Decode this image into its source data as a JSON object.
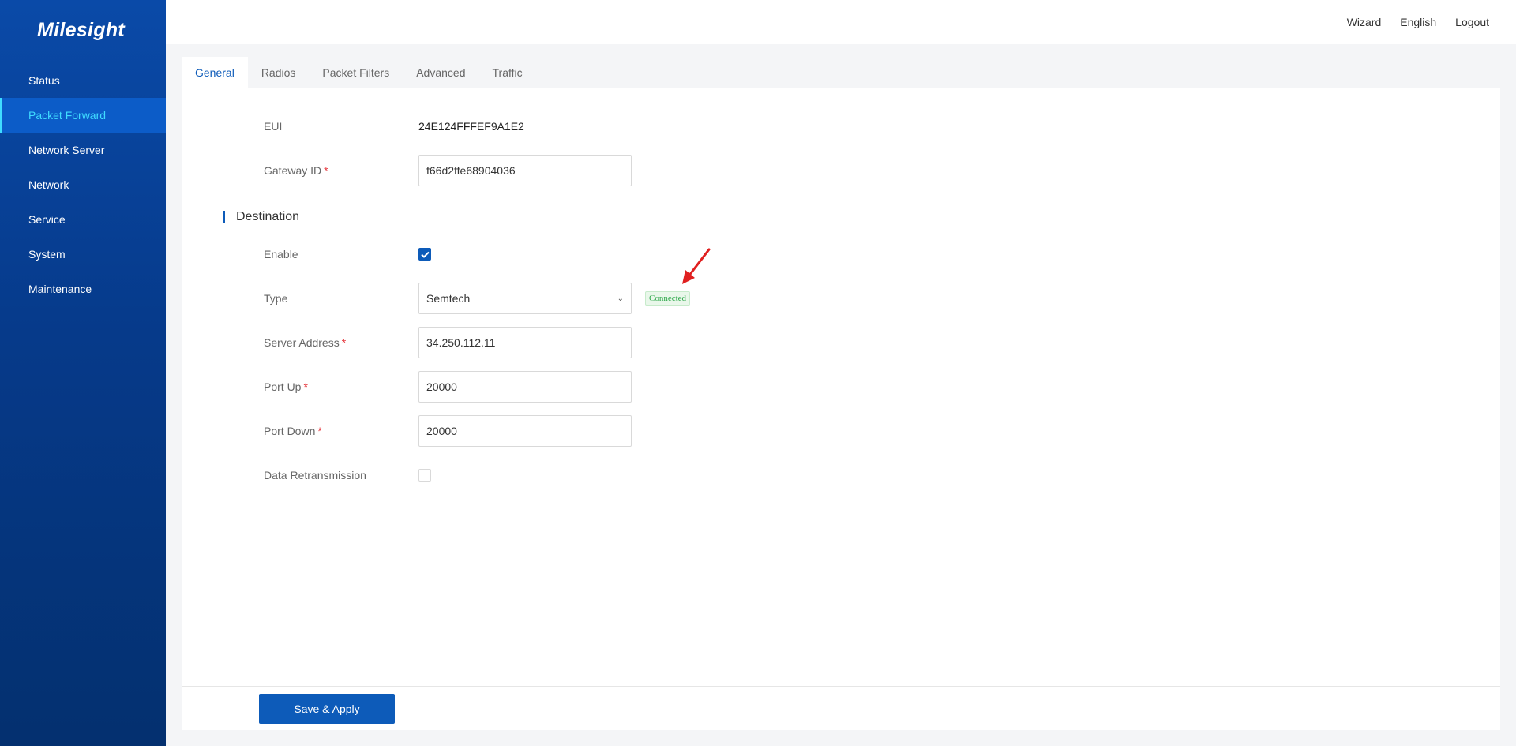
{
  "brand": {
    "logo_text": "Milesight"
  },
  "sidebar": {
    "items": [
      {
        "label": "Status"
      },
      {
        "label": "Packet Forward",
        "active": true
      },
      {
        "label": "Network Server"
      },
      {
        "label": "Network"
      },
      {
        "label": "Service"
      },
      {
        "label": "System"
      },
      {
        "label": "Maintenance"
      }
    ]
  },
  "header": {
    "wizard": "Wizard",
    "language": "English",
    "logout": "Logout"
  },
  "tabs": [
    {
      "label": "General",
      "active": true
    },
    {
      "label": "Radios"
    },
    {
      "label": "Packet Filters"
    },
    {
      "label": "Advanced"
    },
    {
      "label": "Traffic"
    }
  ],
  "form": {
    "eui": {
      "label": "EUI",
      "value": "24E124FFFEF9A1E2"
    },
    "gateway_id": {
      "label": "Gateway ID",
      "required": "*",
      "value": "f66d2ffe68904036"
    },
    "destination": {
      "title": "Destination"
    },
    "enable": {
      "label": "Enable",
      "checked": true
    },
    "type": {
      "label": "Type",
      "value": "Semtech",
      "status": "Connected"
    },
    "server_address": {
      "label": "Server Address",
      "required": "*",
      "value": "34.250.112.11"
    },
    "port_up": {
      "label": "Port Up",
      "required": "*",
      "value": "20000"
    },
    "port_down": {
      "label": "Port Down",
      "required": "*",
      "value": "20000"
    },
    "data_retransmission": {
      "label": "Data Retransmission",
      "checked": false
    }
  },
  "actions": {
    "save_label": "Save & Apply"
  },
  "colors": {
    "sidebar_bg": "#0a4aa8",
    "accent": "#0d5bb9",
    "active_nav_text": "#3fdcff",
    "status_green": "#2ea84a",
    "required_red": "#e6383e",
    "annotation_arrow": "#e02020"
  }
}
